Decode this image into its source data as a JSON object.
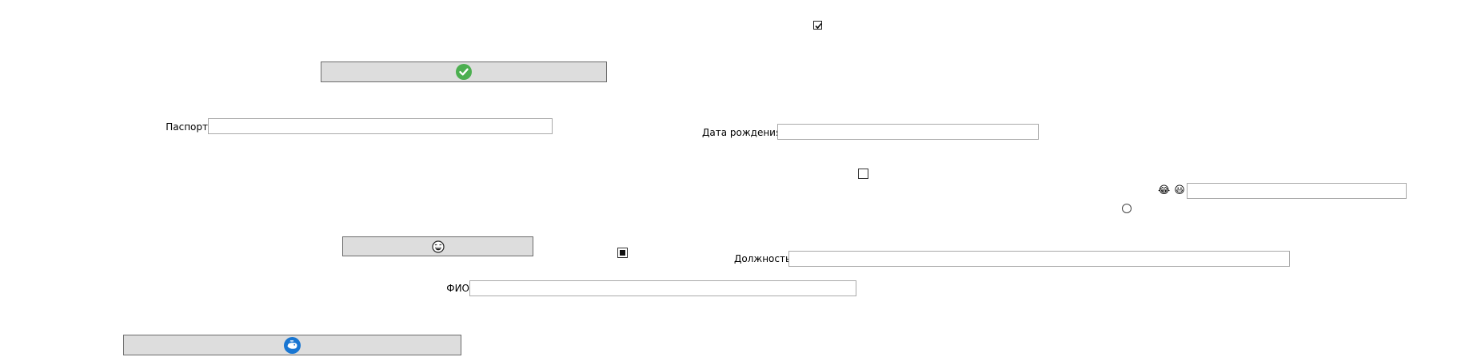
{
  "form": {
    "passport": {
      "label": "Паспорт",
      "value": ""
    },
    "birth_date": {
      "label": "Дата рождения",
      "value": ""
    },
    "position": {
      "label": "Должность",
      "value": ""
    },
    "full_name": {
      "label": "ФИО",
      "value": ""
    },
    "emoji_field": {
      "value": ""
    }
  },
  "controls": {
    "checkbox_top": {
      "state": "checked"
    },
    "checkbox_middle": {
      "state": "unchecked"
    },
    "checkbox_lower": {
      "state": "indeterminate"
    },
    "radio": {
      "state": "unselected"
    }
  },
  "buttons": {
    "confirm": {
      "icon": "green-check-circle-icon",
      "icon_color": "#4caf50"
    },
    "emoji": {
      "icon": "laughing-face-icon"
    },
    "bottom": {
      "icon": "blue-whale-circle-icon",
      "icon_color": "#1976d2"
    }
  },
  "emoji_labels": {
    "first": "😂",
    "second": "😃"
  }
}
